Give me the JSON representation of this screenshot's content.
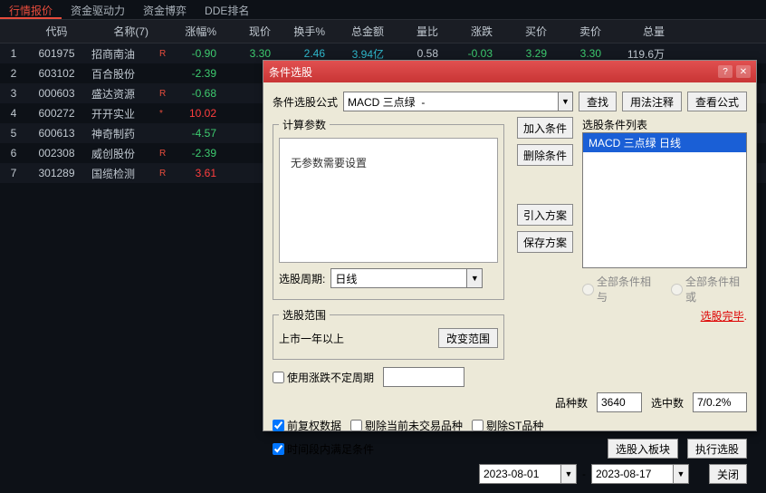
{
  "tabs": [
    "行情报价",
    "资金驱动力",
    "资金博弈",
    "DDE排名"
  ],
  "table": {
    "headers": [
      "",
      "代码",
      "名称(7)",
      "",
      "涨幅%",
      "现价",
      "换手%",
      "总金额",
      "量比",
      "涨跌",
      "买价",
      "卖价",
      "总量"
    ],
    "rows": [
      {
        "idx": "1",
        "code": "601975",
        "name": "招商南油",
        "r": "R",
        "chg": "-0.90",
        "price": "3.30",
        "turn": "2.46",
        "amt": "3.94亿",
        "ratio": "0.58",
        "diff": "-0.03",
        "buy": "3.29",
        "sell": "3.30",
        "vol": "119.6万",
        "chgCls": "green",
        "priceCls": "green",
        "turnCls": "cyan",
        "amtCls": "cyan",
        "ratioCls": "",
        "diffCls": "green",
        "buyCls": "green",
        "sellCls": "green"
      },
      {
        "idx": "2",
        "code": "603102",
        "name": "百合股份",
        "r": "",
        "chg": "-2.39",
        "chgCls": "green"
      },
      {
        "idx": "3",
        "code": "000603",
        "name": "盛达资源",
        "r": "R",
        "chg": "-0.68",
        "chgCls": "green"
      },
      {
        "idx": "4",
        "code": "600272",
        "name": "开开实业",
        "r": "*",
        "chg": "10.02",
        "chgCls": "red"
      },
      {
        "idx": "5",
        "code": "600613",
        "name": "神奇制药",
        "r": "",
        "chg": "-4.57",
        "chgCls": "green"
      },
      {
        "idx": "6",
        "code": "002308",
        "name": "威创股份",
        "r": "R",
        "chg": "-2.39",
        "chgCls": "green"
      },
      {
        "idx": "7",
        "code": "301289",
        "name": "国缆检测",
        "r": "R",
        "chg": "3.61",
        "chgCls": "red"
      }
    ]
  },
  "dialog": {
    "title": "条件选股",
    "formula_label": "条件选股公式",
    "formula_value": "MACD 三点绿  -",
    "find": "查找",
    "usage": "用法注释",
    "view_formula": "查看公式",
    "param_group": "计算参数",
    "param_msg": "无参数需要设置",
    "period_label": "选股周期:",
    "period_value": "日线",
    "range_group": "选股范围",
    "range_text": "上市一年以上",
    "change_range": "改变范围",
    "add_cond": "加入条件",
    "del_cond": "删除条件",
    "import_plan": "引入方案",
    "save_plan": "保存方案",
    "cond_list_label": "选股条件列表",
    "cond_item": "MACD 三点绿  日线",
    "radio_and": "全部条件相与",
    "radio_or": "全部条件相或",
    "status": "选股完毕",
    "use_var_period": "使用涨跌不定周期",
    "count_label": "品种数",
    "count_value": "3640",
    "sel_label": "选中数",
    "sel_value": "7/0.2%",
    "chk_adj": "前复权数据",
    "chk_excl_notrade": "剔除当前未交易品种",
    "chk_excl_st": "剔除ST品种",
    "chk_time_satisfy": "时间段内满足条件",
    "add_sector": "选股入板块",
    "run": "执行选股",
    "date_from": "2023-08-01",
    "date_to": "2023-08-17",
    "dash": "-",
    "close": "关闭"
  }
}
